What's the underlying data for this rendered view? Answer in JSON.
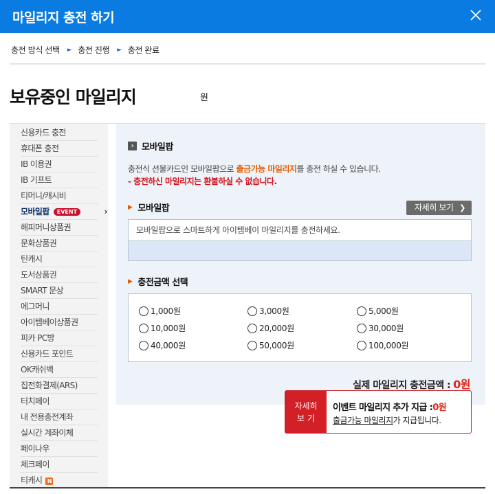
{
  "window": {
    "title": "마일리지 충전 하기",
    "close_icon": "close-icon"
  },
  "steps": {
    "items": [
      "충전 방식 선택",
      "충전 진행",
      "충전 완료"
    ],
    "arrow_icon": "arrow-right-icon"
  },
  "balance": {
    "heading": "보유중인 마일리지",
    "unit": "원"
  },
  "sidebar": {
    "items": [
      {
        "label": "신용카드 충전"
      },
      {
        "label": "휴대폰 충전"
      },
      {
        "label": "IB 이용권"
      },
      {
        "label": "IB 기프트"
      },
      {
        "label": "티머니/캐시비"
      },
      {
        "label": "모바일팝",
        "badge": "EVENT",
        "active": true
      },
      {
        "label": "해피머니상품권"
      },
      {
        "label": "문화상품권"
      },
      {
        "label": "틴캐시"
      },
      {
        "label": "도서상품권"
      },
      {
        "label": "SMART 문상"
      },
      {
        "label": "에그머니"
      },
      {
        "label": "아이템베이상품권"
      },
      {
        "label": "피카 PC방"
      },
      {
        "label": "신용카드 포인트"
      },
      {
        "label": "OK캐쉬백"
      },
      {
        "label": "집전화결제(ARS)"
      },
      {
        "label": "터치페이"
      },
      {
        "label": "내 전용충전계좌"
      },
      {
        "label": "실시간 계좌이체"
      },
      {
        "label": "페이나우"
      },
      {
        "label": "체크페이"
      },
      {
        "label": "티캐시",
        "new_badge": "N"
      }
    ]
  },
  "main": {
    "section_title": "모바일팝",
    "desc": {
      "line1_pre": "충전식 선불카드인 모바일팝으로 ",
      "line1_hl": "출금가능 마일리지",
      "line1_post": "를 충전 하실 수 있습니다.",
      "line2": "- 충전하신 마일리지는 환불하실 수 없습니다."
    },
    "mobilepop": {
      "title": "모바일팝",
      "detail_button": "자세히 보기",
      "info": "모바일팝으로 스마트하게 아이템베이 마일리지를 충전하세요."
    },
    "amount": {
      "title": "충전금액 선택",
      "options": [
        "1,000원",
        "3,000원",
        "5,000원",
        "10,000원",
        "20,000원",
        "30,000원",
        "40,000원",
        "50,000원",
        "100,000원"
      ]
    },
    "actual": {
      "label": "실제 마일리지 충전금액 :",
      "value": "0원"
    },
    "event": {
      "detail_line1": "자세히",
      "detail_line2": "보 기",
      "line1_pre": "이벤트 마일리지 추가 지급 :",
      "line1_value": "0원",
      "line2_link": "출금가능 마일리지",
      "line2_post": "가 지급됩니다."
    }
  },
  "colors": {
    "topbar": "#0a7be0",
    "accent_orange": "#e65a00",
    "alert_red": "#d4131b",
    "event_red": "#d31f26"
  }
}
